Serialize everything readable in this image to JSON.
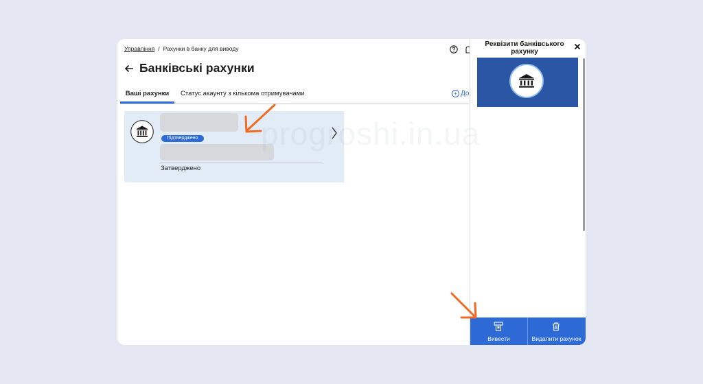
{
  "breadcrumb": {
    "root": "Управління",
    "separator": "/",
    "current": "Рахунки в банку для виводу"
  },
  "page": {
    "title": "Банківські рахунки"
  },
  "tabs": [
    {
      "label": "Ваші рахунки",
      "active": true
    },
    {
      "label": "Статус акаунту з кількома отримувачами",
      "active": false
    }
  ],
  "add_link": {
    "label": "До"
  },
  "account_card": {
    "badge": "Підтверджено",
    "status": "Затверджено"
  },
  "details_panel": {
    "title": "Реквізити банківського рахунку"
  },
  "actions": {
    "withdraw_label": "Вивести",
    "delete_label": "Видалити рахунок"
  },
  "watermark": "progroshi.in.ua",
  "colors": {
    "background": "#e4e6f2",
    "accent": "#2e6ad6",
    "card_bg": "#e1ecf7",
    "banner": "#2b56a6",
    "annotation_arrow": "#f26a21"
  },
  "icons": {
    "help": "help-icon",
    "notification": "bell-icon",
    "back": "back-arrow-icon",
    "bank": "bank-icon",
    "chevron": "chevron-right-icon",
    "close": "close-icon",
    "withdraw": "atm-icon",
    "delete": "trash-icon"
  }
}
